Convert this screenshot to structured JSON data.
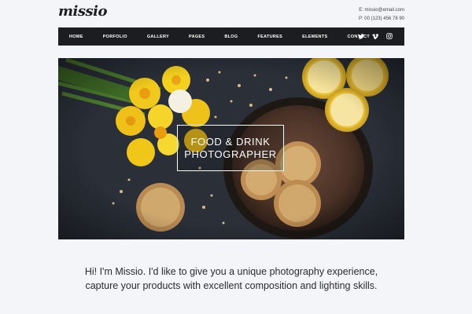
{
  "header": {
    "logo": "missio",
    "email": "E: missio@email.com",
    "phone": "P: 00 (123) 456 78 90"
  },
  "nav": {
    "items": [
      {
        "label": "HOME"
      },
      {
        "label": "PORFOLIO"
      },
      {
        "label": "GALLERY"
      },
      {
        "label": "PAGES"
      },
      {
        "label": "BLOG"
      },
      {
        "label": "FEATURES"
      },
      {
        "label": "ELEMENTS"
      },
      {
        "label": "CONTACT"
      }
    ],
    "social": [
      "twitter-icon",
      "vimeo-icon",
      "instagram-icon"
    ]
  },
  "hero": {
    "line1": "FOOD & DRINK",
    "line2": "PHOTOGRAPHER"
  },
  "intro": {
    "line1": "Hi! I'm Missio. I'd like to give you a unique photography experience,",
    "line2": "capture your products with excellent composition and lighting skills."
  },
  "colors": {
    "background": "#f4f5f9",
    "nav": "#1c1d20",
    "hero": "#262a33",
    "accent_yellow": "#f2c21b",
    "lemon": "#e7c23a"
  }
}
